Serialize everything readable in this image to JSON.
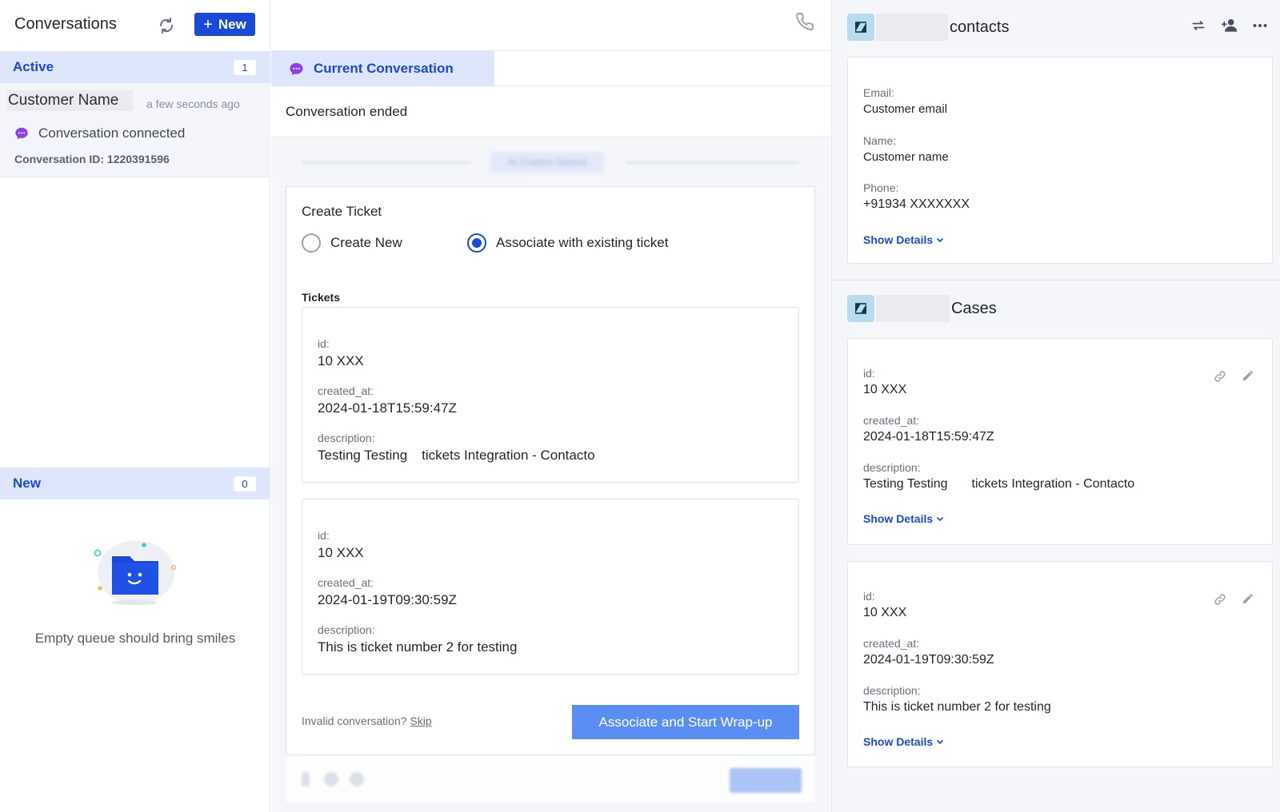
{
  "left": {
    "title": "Conversations",
    "new_button_label": "New",
    "active_section": {
      "label": "Active",
      "count": "1"
    },
    "conversation": {
      "customer_name": "Customer Name",
      "time": "a few seconds ago",
      "status": "Conversation connected",
      "conversation_id": "Conversation ID: 1220391596"
    },
    "new_section": {
      "label": "New",
      "count": "0"
    },
    "empty_text": "Empty queue should bring smiles"
  },
  "center": {
    "tab_label": "Current Conversation",
    "conversation_ended": "Conversation ended",
    "blurred_banner": "AI Chatbot Started",
    "form": {
      "title": "Create Ticket",
      "radio_create_new": "Create New",
      "radio_associate": "Associate with existing ticket",
      "selected": "associate",
      "tickets_label": "Tickets",
      "tickets": [
        {
          "id_label": "id:",
          "id": "10 XXX",
          "created_label": "created_at:",
          "created_at": "2024-01-18T15:59:47Z",
          "desc_label": "description:",
          "description": "Testing Testing",
          "description_tail": "tickets Integration - Contacto"
        },
        {
          "id_label": "id:",
          "id": "10 XXX",
          "created_label": "created_at:",
          "created_at": "2024-01-19T09:30:59Z",
          "desc_label": "description:",
          "description": "This is ticket number 2 for testing",
          "description_tail": ""
        }
      ],
      "invalid_text": "Invalid conversation?",
      "skip_label": "Skip",
      "associate_button": "Associate and Start Wrap-up"
    }
  },
  "right": {
    "contacts_title": "contacts",
    "contact": {
      "email_label": "Email:",
      "email": "Customer email",
      "name_label": "Name:",
      "name": "Customer name",
      "phone_label": "Phone:",
      "phone": "+91934 XXXXXXX",
      "show_details": "Show Details"
    },
    "cases_title": "Cases",
    "cases": [
      {
        "id_label": "id:",
        "id": "10 XXX",
        "created_label": "created_at:",
        "created_at": "2024-01-18T15:59:47Z",
        "desc_label": "description:",
        "description": "Testing Testing",
        "description_tail": "tickets Integration - Contacto",
        "show_details": "Show Details"
      },
      {
        "id_label": "id:",
        "id": "10 XXX",
        "created_label": "created_at:",
        "created_at": "2024-01-19T09:30:59Z",
        "desc_label": "description:",
        "description": "This is ticket number 2 for testing",
        "description_tail": "",
        "show_details": "Show Details"
      }
    ]
  },
  "colors": {
    "accent": "#1849d8",
    "accent_light": "#dde6fa",
    "button_blue": "#5b8ef5",
    "chat_icon": "#8b3df0",
    "zendesk_logo_bg": "#b8dcec"
  },
  "icons": {
    "refresh": "refresh-icon",
    "plus": "plus-icon",
    "chat": "chat-bubble-icon",
    "phone": "phone-icon",
    "swap": "swap-icon",
    "add_user": "add-user-icon",
    "more": "more-horizontal-icon",
    "link": "link-icon",
    "edit": "pencil-icon",
    "chevron": "chevron-down-icon",
    "logo": "zendesk-logo-icon"
  }
}
